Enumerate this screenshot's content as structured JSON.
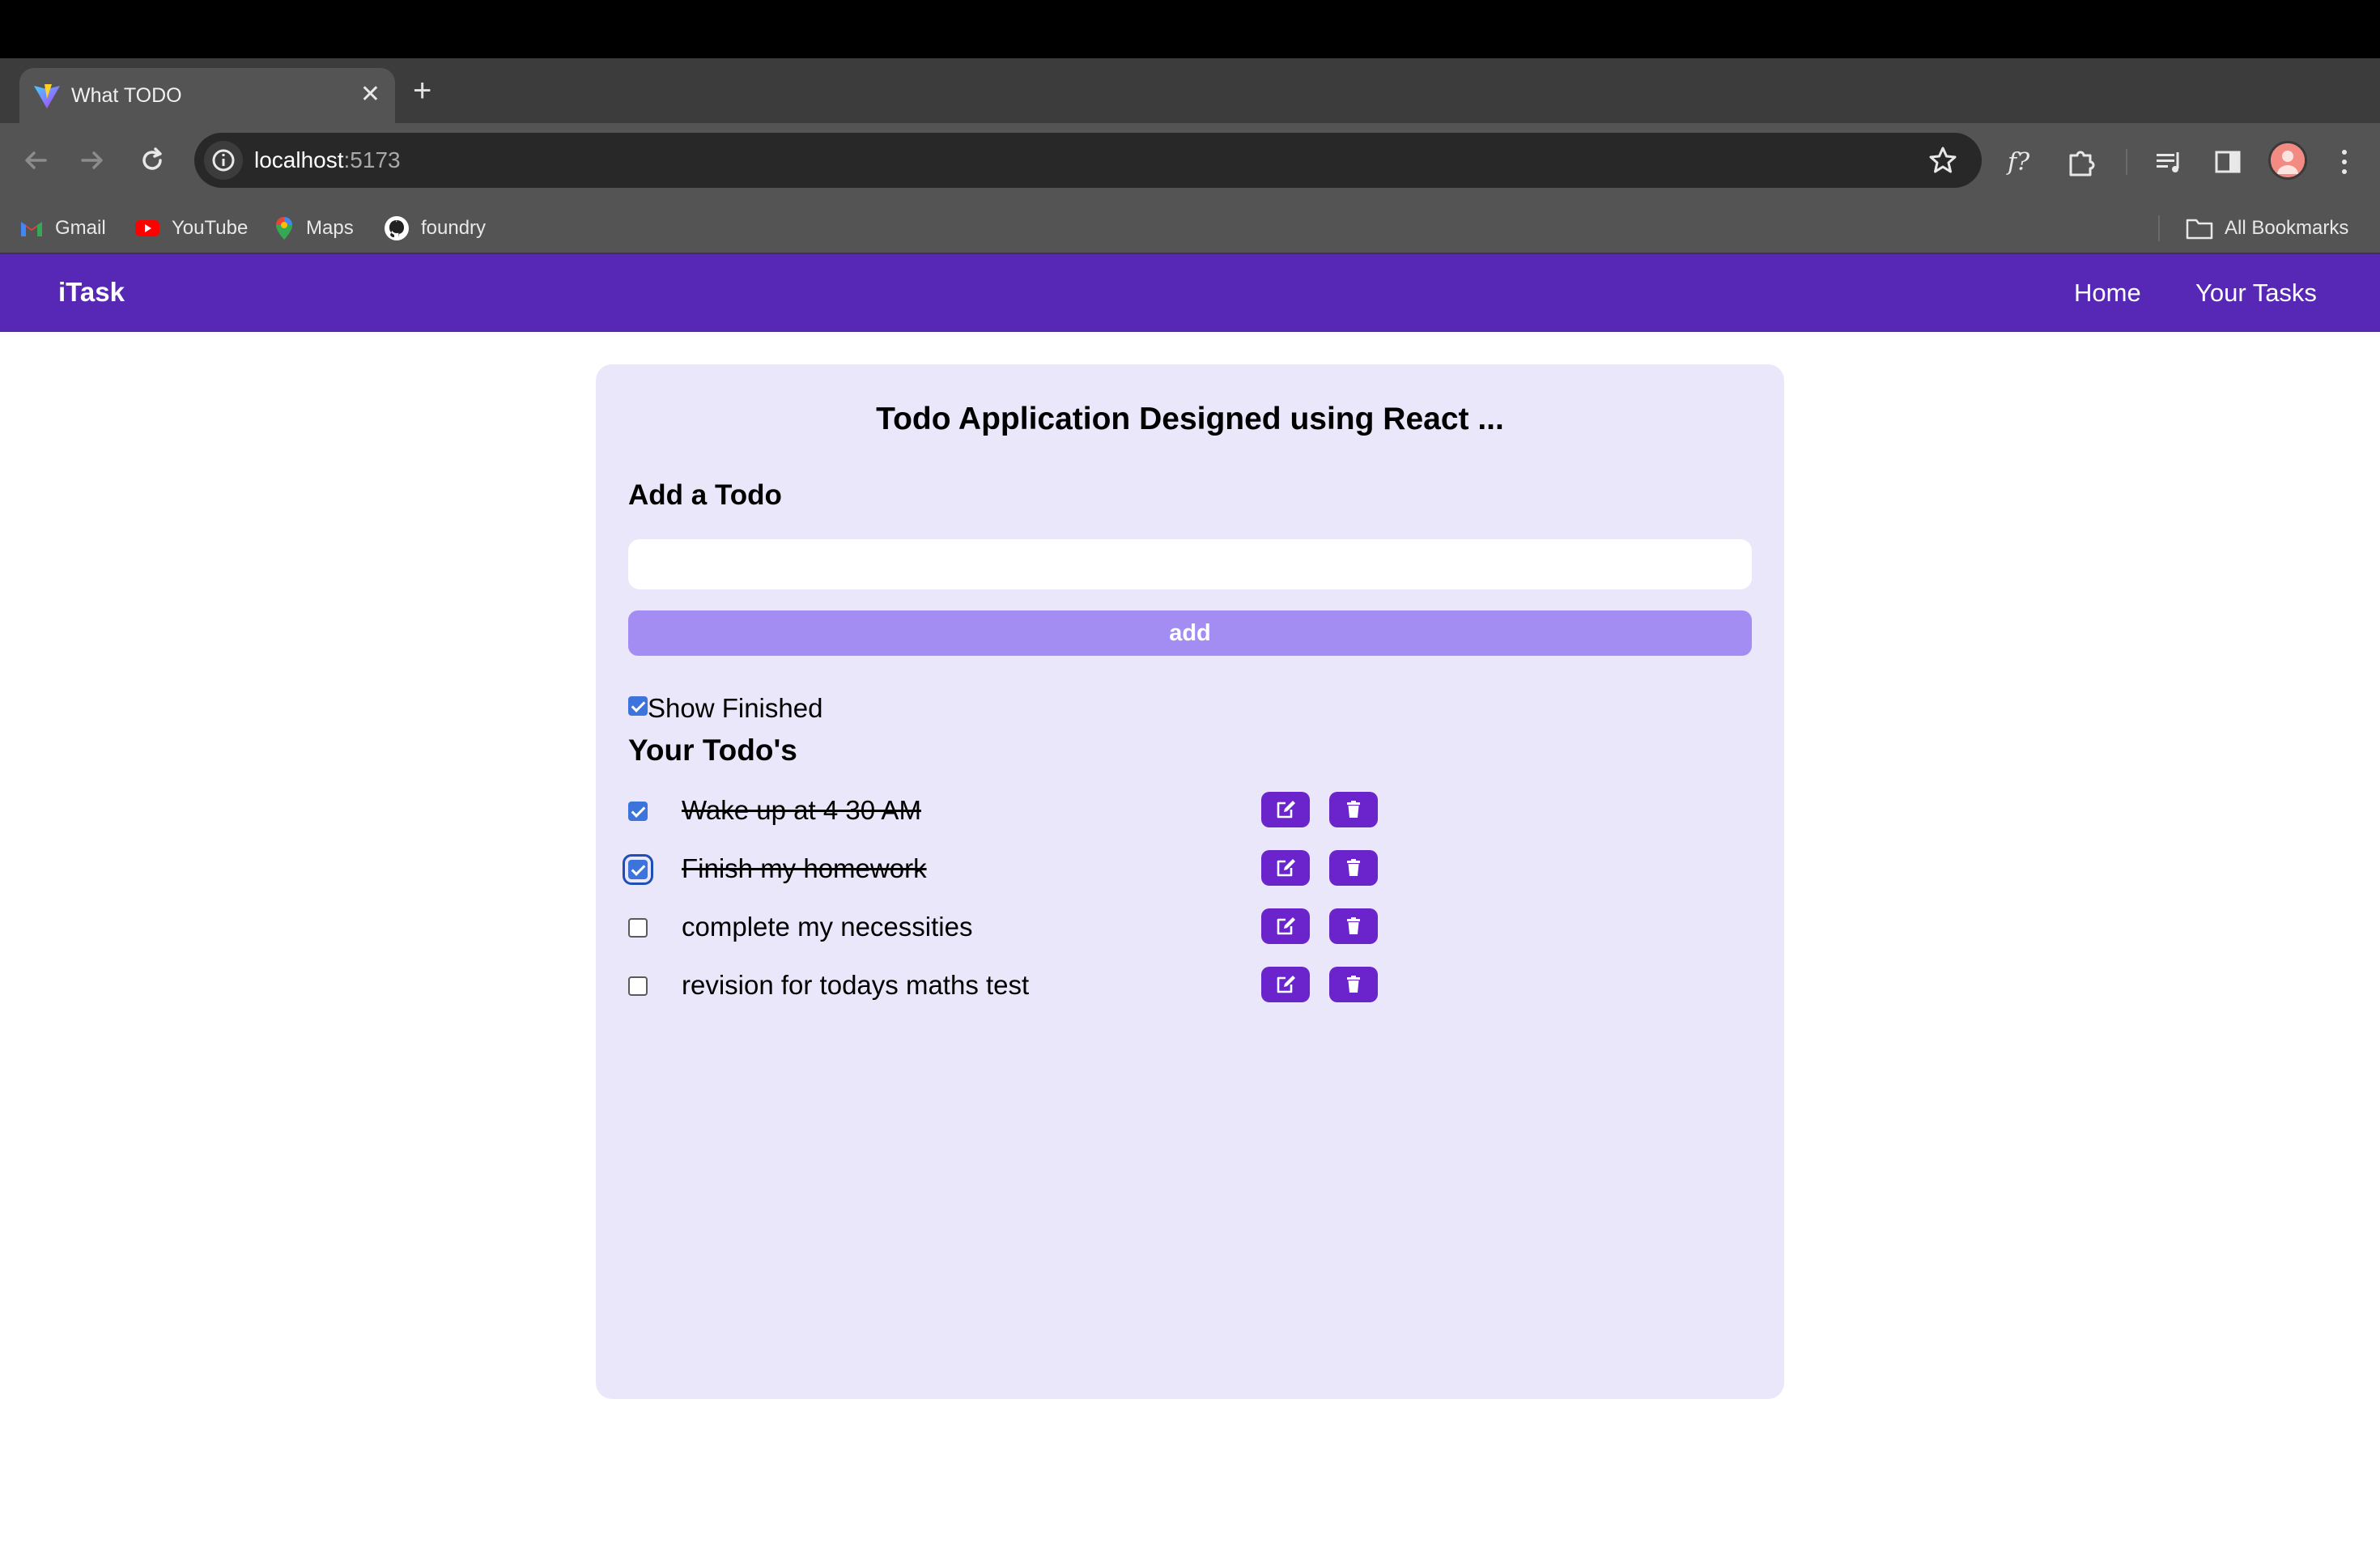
{
  "browser": {
    "tab_title": "What TODO",
    "url_host": "localhost",
    "url_port": ":5173",
    "bookmarks": [
      "Gmail",
      "YouTube",
      "Maps",
      "foundry"
    ],
    "all_bookmarks": "All Bookmarks"
  },
  "app": {
    "brand": "iTask",
    "nav": [
      "Home",
      "Your Tasks"
    ],
    "title": "Todo Application Designed using React ...",
    "add_heading": "Add a Todo",
    "input_value": "",
    "add_button": "add",
    "show_finished_label": "Show Finished",
    "show_finished_checked": true,
    "todos_heading": "Your Todo's",
    "todos": [
      {
        "text": "Wake up at 4 30 AM",
        "done": true
      },
      {
        "text": "Finish my homework",
        "done": true
      },
      {
        "text": "complete my necessities",
        "done": false
      },
      {
        "text": "revision for todays maths test",
        "done": false
      }
    ]
  },
  "colors": {
    "navbar": "#5727b5",
    "card": "#ebe7fa",
    "add_button": "#a38cf2",
    "action_button": "#6b24cc",
    "checkbox": "#3d74db"
  }
}
